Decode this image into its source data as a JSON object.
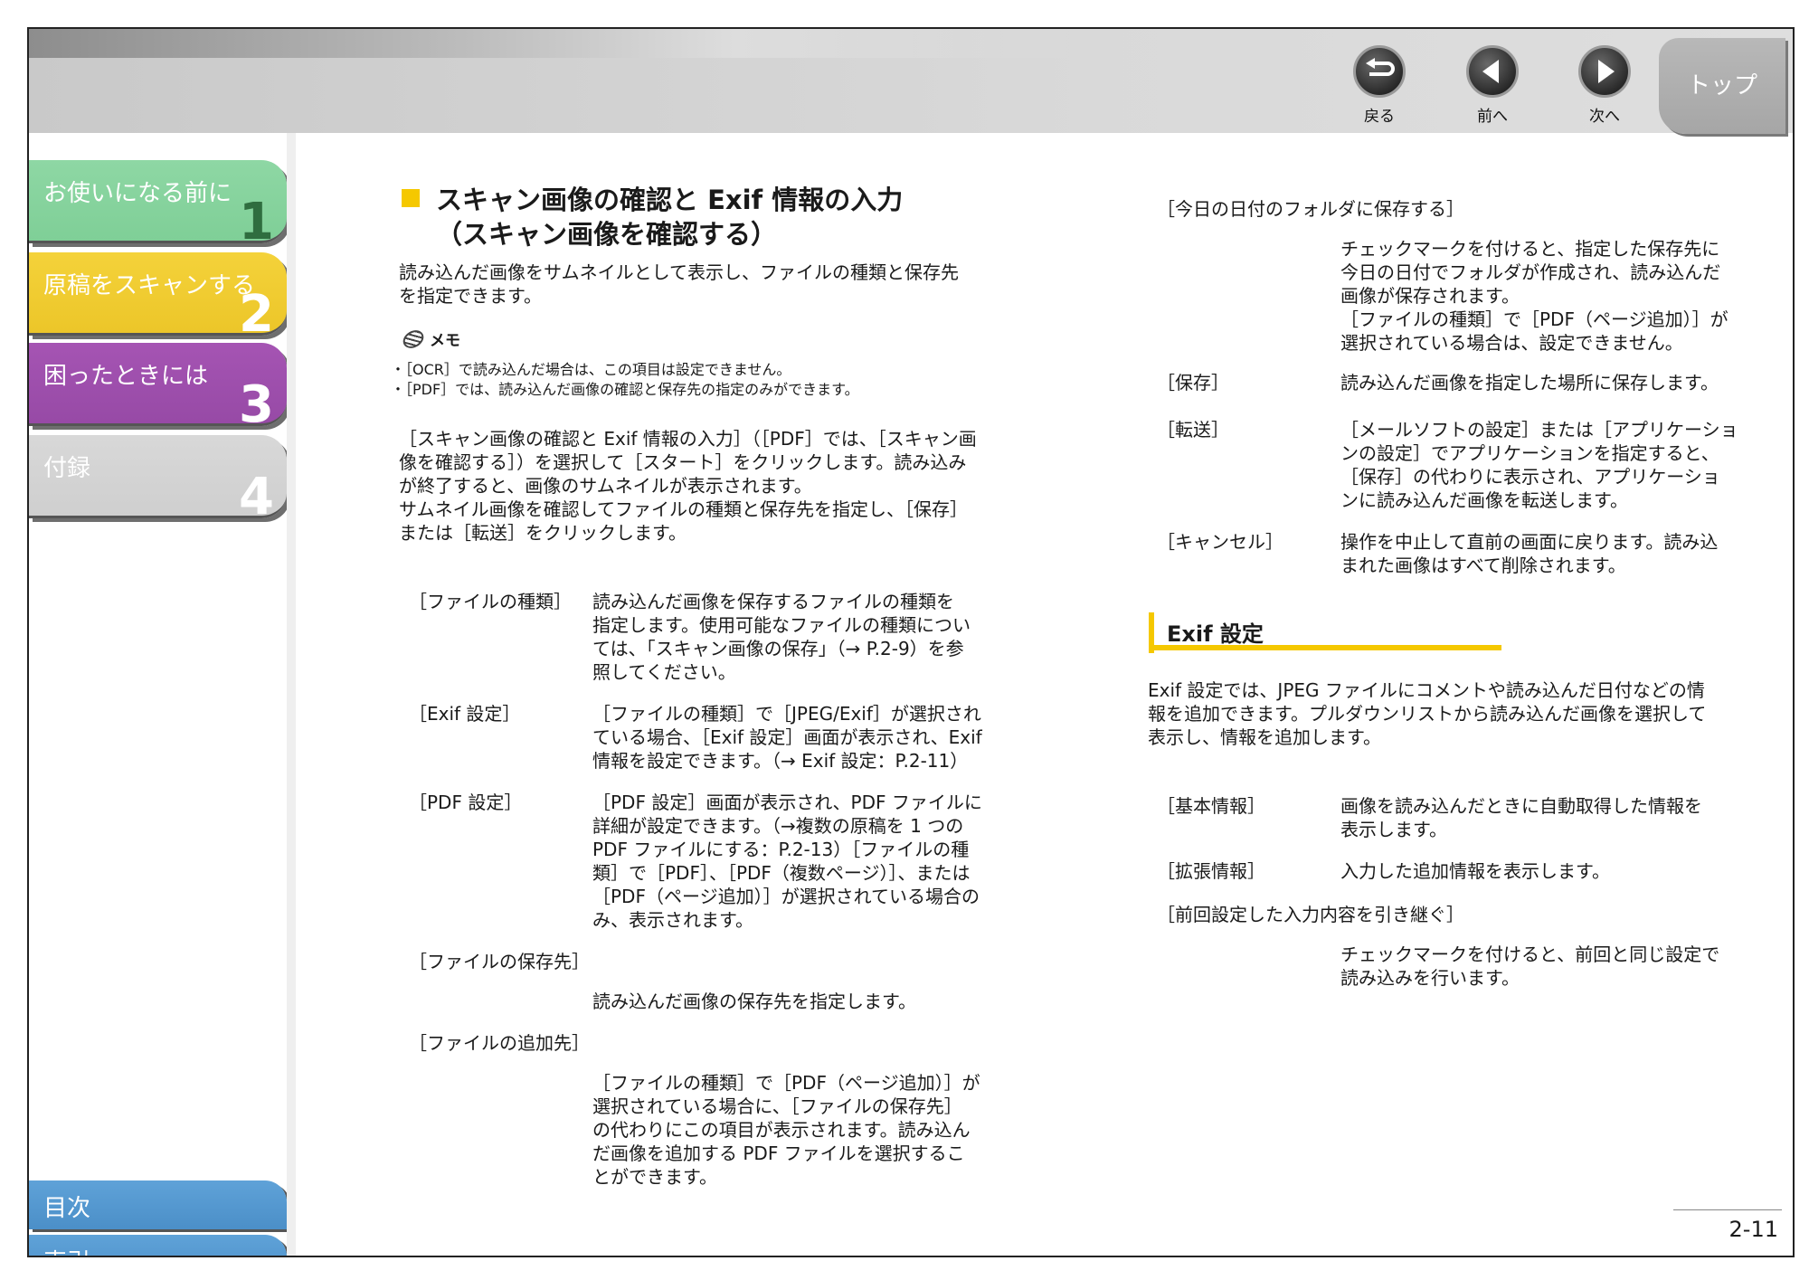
{
  "nav": {
    "back_label": "戻る",
    "prev_label": "前へ",
    "next_label": "次へ",
    "top_label": "トップ"
  },
  "sidebar": {
    "chapters": [
      {
        "title": "お使いになる前に",
        "number": "1"
      },
      {
        "title": "原稿をスキャンする",
        "number": "2"
      },
      {
        "title": "困ったときには",
        "number": "3"
      },
      {
        "title": "付録",
        "number": "4"
      }
    ],
    "contents_label": "目次",
    "index_label": "索引"
  },
  "main": {
    "title_line1": "スキャン画像の確認と Exif 情報の入力",
    "title_line2": "（スキャン画像を確認する）",
    "intro": [
      "読み込んだ画像をサムネイルとして表示し、ファイルの種類と保存先",
      "を指定できます。"
    ],
    "memo_label": "メモ",
    "memo_items": [
      "・［OCR］で読み込んだ場合は、この項目は設定できません。",
      "・［PDF］では、読み込んだ画像の確認と保存先の指定のみができます。"
    ],
    "body": [
      "［スキャン画像の確認と Exif 情報の入力］（［PDF］では、［スキャン画",
      "像を確認する］）を選択して［スタート］をクリックします。読み込み",
      "が終了すると、画像のサムネイルが表示されます。",
      "サムネイル画像を確認してファイルの種類と保存先を指定し、［保存］",
      "または［転送］をクリックします。"
    ],
    "left_terms": [
      {
        "term": "［ファイルの種類］",
        "desc": [
          "読み込んだ画像を保存するファイルの種類を",
          "指定します。使用可能なファイルの種類につい",
          "ては、「スキャン画像の保存」（→ P.2-9）を参",
          "照してください。"
        ]
      },
      {
        "term": "［Exif 設定］",
        "desc": [
          "［ファイルの種類］で［JPEG/Exif］が選択され",
          "ている場合、［Exif 設定］画面が表示され、Exif",
          "情報を設定できます。（→ Exif 設定：P.2-11）"
        ]
      },
      {
        "term": "［PDF 設定］",
        "desc": [
          "［PDF 設定］画面が表示され、PDF ファイルに",
          "詳細が設定できます。（→複数の原稿を 1 つの",
          "PDF ファイルにする：P.2-13）［ファイルの種",
          "類］で［PDF］、［PDF（複数ページ）］、または",
          "［PDF（ページ追加）］が選択されている場合の",
          "み、表示されます。"
        ]
      },
      {
        "term": "［ファイルの保存先］",
        "desc": [
          "読み込んだ画像の保存先を指定します。"
        ]
      },
      {
        "term": "［ファイルの追加先］",
        "desc": [
          "［ファイルの種類］で［PDF（ページ追加）］が",
          "選択されている場合に、［ファイルの保存先］",
          "の代わりにこの項目が表示されます。読み込ん",
          "だ画像を追加する PDF ファイルを選択するこ",
          "とができます。"
        ]
      }
    ],
    "right_terms": [
      {
        "term": "［今日の日付のフォルダに保存する］",
        "desc": [
          "チェックマークを付けると、指定した保存先に",
          "今日の日付でフォルダが作成され、読み込んだ",
          "画像が保存されます。",
          "［ファイルの種類］で［PDF（ページ追加）］が",
          "選択されている場合は、設定できません。"
        ]
      },
      {
        "term": "［保存］",
        "desc": [
          "読み込んだ画像を指定した場所に保存します。"
        ]
      },
      {
        "term": "［転送］",
        "desc": [
          "［メールソフトの設定］または［アプリケーショ",
          "ンの設定］でアプリケーションを指定すると、",
          "［保存］の代わりに表示され、アプリケーショ",
          "ンに読み込んだ画像を転送します。"
        ]
      },
      {
        "term": "［キャンセル］",
        "desc": [
          "操作を中止して直前の画面に戻ります。読み込",
          "まれた画像はすべて削除されます。"
        ]
      }
    ],
    "exif_title": "Exif 設定",
    "exif_body": [
      "Exif 設定では、JPEG ファイルにコメントや読み込んだ日付などの情",
      "報を追加できます。プルダウンリストから読み込んだ画像を選択して",
      "表示し、情報を追加します。"
    ],
    "exif_terms": [
      {
        "term": "［基本情報］",
        "desc": [
          "画像を読み込んだときに自動取得した情報を",
          "表示します。"
        ]
      },
      {
        "term": "［拡張情報］",
        "desc": [
          "入力した追加情報を表示します。"
        ]
      },
      {
        "term": "［前回設定した入力内容を引き継ぐ］",
        "desc": [
          "チェックマークを付けると、前回と同じ設定で",
          "読み込みを行います。"
        ]
      }
    ],
    "page_number": "2-11"
  }
}
